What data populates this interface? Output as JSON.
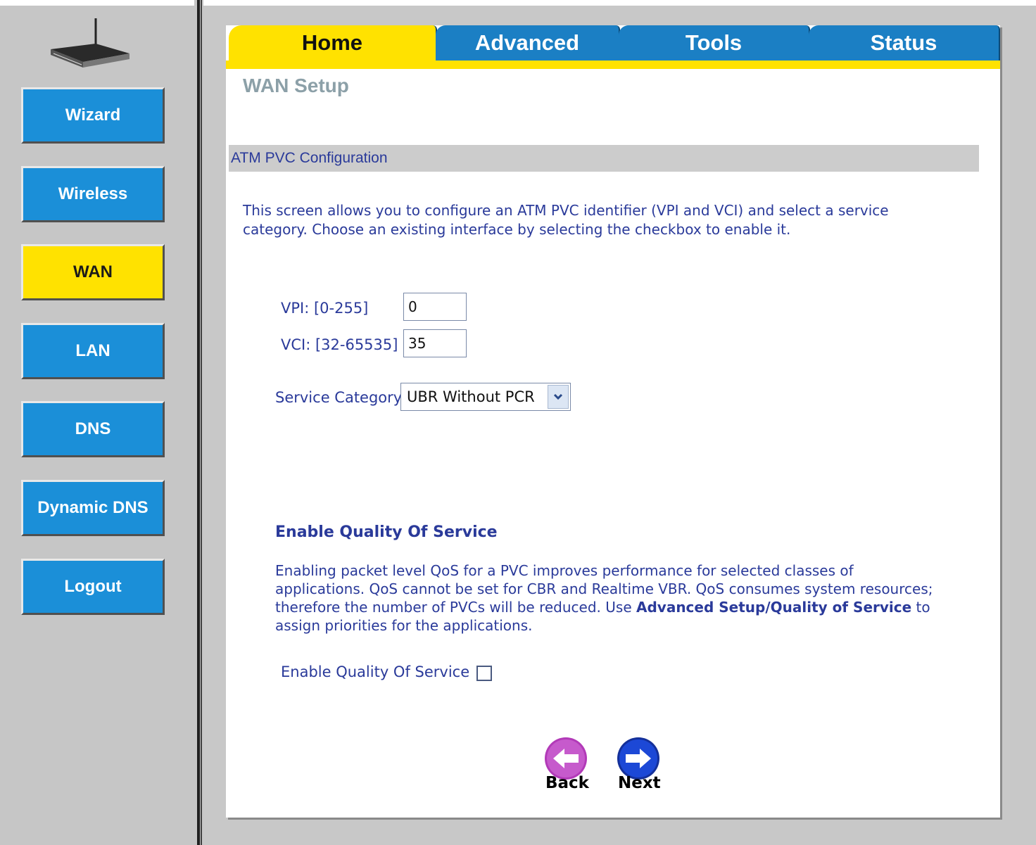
{
  "sidebar": {
    "items": [
      {
        "label": "Wizard",
        "active": false
      },
      {
        "label": "Wireless",
        "active": false
      },
      {
        "label": "WAN",
        "active": true
      },
      {
        "label": "LAN",
        "active": false
      },
      {
        "label": "DNS",
        "active": false
      },
      {
        "label": "Dynamic DNS",
        "active": false
      },
      {
        "label": "Logout",
        "active": false
      }
    ]
  },
  "tabs": [
    {
      "label": "Home",
      "active": true
    },
    {
      "label": "Advanced",
      "active": false
    },
    {
      "label": "Tools",
      "active": false
    },
    {
      "label": "Status",
      "active": false
    }
  ],
  "page": {
    "title": "WAN Setup",
    "section_header": "ATM PVC Configuration",
    "description": "This screen allows you to configure an ATM PVC identifier (VPI and VCI) and select a service category. Choose an existing interface by selecting the checkbox to enable it."
  },
  "form": {
    "vpi_label": "VPI: [0-255]",
    "vpi_value": "0",
    "vci_label": "VCI: [32-65535]",
    "vci_value": "35",
    "service_category_label": "Service Category:",
    "service_category_value": "UBR Without PCR"
  },
  "qos": {
    "title": "Enable Quality Of Service",
    "desc_part1": "Enabling packet level QoS for a PVC improves performance for selected classes of applications.  QoS cannot be set for CBR and Realtime VBR.  QoS consumes system resources; therefore the number of PVCs will be reduced. Use ",
    "desc_link": "Advanced Setup/Quality of Service",
    "desc_part2": " to assign priorities for the applications.",
    "checkbox_label": "Enable Quality Of Service",
    "checkbox_checked": false
  },
  "buttons": {
    "back_label": "Back",
    "next_label": "Next"
  },
  "colors": {
    "accent_yellow": "#ffe200",
    "tab_blue": "#1b7fc4",
    "nav_blue": "#1b8fd8",
    "text_blue": "#2a3a9a",
    "back_purple": "#c040c0",
    "next_blue": "#1a3fd0"
  }
}
